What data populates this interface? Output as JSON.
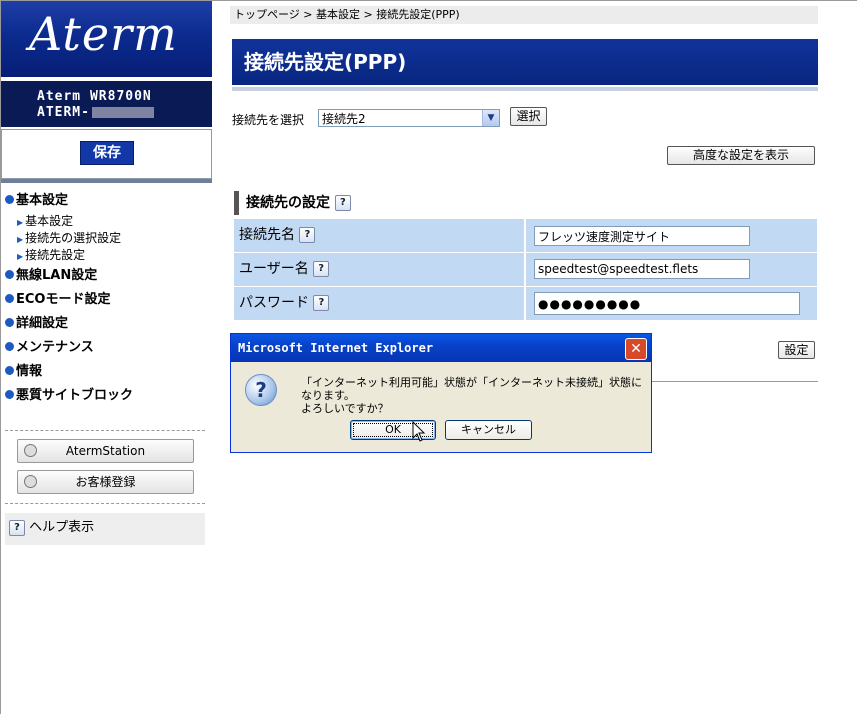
{
  "sidebar": {
    "logo": "Aterm",
    "model_line1": "Aterm WR8700N",
    "model_line2": "ATERM-",
    "save_label": "保存",
    "menu": [
      {
        "label": "基本設定",
        "subs": [
          "基本設定",
          "接続先の選択設定",
          "接続先設定"
        ]
      },
      {
        "label": "無線LAN設定"
      },
      {
        "label": "ECOモード設定"
      },
      {
        "label": "詳細設定"
      },
      {
        "label": "メンテナンス"
      },
      {
        "label": "情報"
      },
      {
        "label": "悪質サイトブロック"
      }
    ],
    "aterm_station": "AtermStation",
    "customer_reg": "お客様登録",
    "help": "ヘルプ表示"
  },
  "main": {
    "breadcrumb": "トップページ > 基本設定 > 接続先設定(PPP)",
    "title": "接続先設定(PPP)",
    "select_label": "接続先を選択",
    "select_value": "接続先2",
    "select_button": "選択",
    "advanced_button": "高度な設定を表示",
    "section_title": "接続先の設定",
    "fields": [
      {
        "label": "接続先名",
        "value": "フレッツ速度測定サイト"
      },
      {
        "label": "ユーザー名",
        "value": "speedtest@speedtest.flets"
      },
      {
        "label": "パスワード",
        "value": "●●●●●●●●●"
      }
    ],
    "set_button": "設定"
  },
  "dialog": {
    "title": "Microsoft Internet Explorer",
    "message_line1": "「インターネット利用可能」状態が「インターネット未接続」状態になります。",
    "message_line2": "よろしいですか？",
    "ok": "OK",
    "cancel": "キャンセル"
  },
  "icons": {
    "help": "?",
    "dialog_question": "?",
    "close": "✕",
    "dropdown": "▼"
  }
}
